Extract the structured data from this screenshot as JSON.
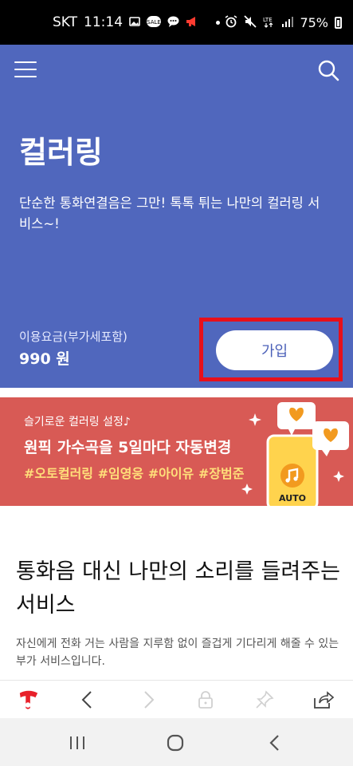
{
  "status_bar": {
    "carrier": "SKT",
    "time": "11:14",
    "battery": "75%",
    "icons": [
      "gallery-icon",
      "sale-icon",
      "chat-icon",
      "megaphone-icon",
      "alarm-icon",
      "mute-icon",
      "lte-icon",
      "signal-icon",
      "battery-icon"
    ],
    "sale_badge": "SALE",
    "lte_label": "LTE"
  },
  "header": {
    "icons": [
      "menu-icon",
      "search-icon"
    ]
  },
  "hero": {
    "title": "컬러링",
    "description": "단순한 통화연결음은 그만! 톡톡 튀는 나만의 컬러링 서비스~!",
    "fee_label": "이용요금(부가세포함)",
    "fee_value": "990 원",
    "join_label": "가입",
    "background": "#5067bd",
    "highlight_color": "#e8101a"
  },
  "banner": {
    "subtitle": "슬기로운 컬러링 설정♪",
    "headline": "원픽 가수곡을 5일마다 자동변경",
    "tags": "#오토컬러링 #임영웅 #아이유 #장범준",
    "art_label": "AUTO",
    "background": "#d85a55",
    "tag_color": "#ffdf7a"
  },
  "content": {
    "title": "통화음 대신 나만의 소리를 들려주는 서비스",
    "description": "자신에게 전화 거는 사람을 지루함 없이 즐겁게 기다리게 해줄 수 있는 부가 서비스입니다."
  },
  "browser_toolbar": {
    "icons": [
      "t-logo-icon",
      "back-icon",
      "forward-icon",
      "lock-icon",
      "pin-icon",
      "share-icon"
    ]
  },
  "nav_bar": {
    "icons": [
      "recent-apps-icon",
      "home-icon",
      "back-icon"
    ]
  }
}
